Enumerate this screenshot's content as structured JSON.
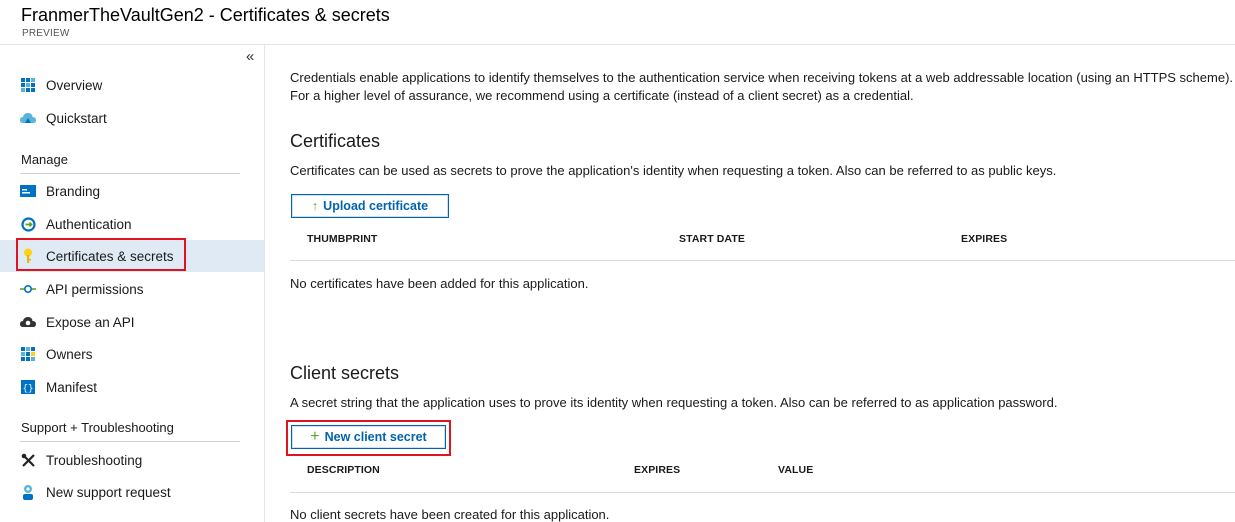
{
  "header": {
    "title": "FranmerTheVaultGen2 - Certificates & secrets",
    "subtitle": "PREVIEW"
  },
  "sidebar": {
    "collapse_glyph": "«",
    "items_top": [
      {
        "label": "Overview",
        "icon": "overview-grid-icon"
      },
      {
        "label": "Quickstart",
        "icon": "cloud-icon"
      }
    ],
    "manage_header": "Manage",
    "manage_items": [
      {
        "label": "Branding",
        "icon": "branding-card-icon"
      },
      {
        "label": "Authentication",
        "icon": "authentication-icon"
      },
      {
        "label": "Certificates & secrets",
        "icon": "key-icon",
        "selected": true
      },
      {
        "label": "API permissions",
        "icon": "api-permissions-icon"
      },
      {
        "label": "Expose an API",
        "icon": "cloud-gear-icon"
      },
      {
        "label": "Owners",
        "icon": "owners-grid-icon"
      },
      {
        "label": "Manifest",
        "icon": "manifest-icon"
      }
    ],
    "support_header": "Support + Troubleshooting",
    "support_items": [
      {
        "label": "Troubleshooting",
        "icon": "wrench-icon"
      },
      {
        "label": "New support request",
        "icon": "support-person-icon"
      }
    ]
  },
  "main": {
    "intro": "Credentials enable applications to identify themselves to the authentication service when receiving tokens at a web addressable location (using an HTTPS scheme). For a higher level of assurance, we recommend using a certificate (instead of a client secret) as a credential.",
    "certificates": {
      "heading": "Certificates",
      "description": "Certificates can be used as secrets to prove the application's identity when requesting a token. Also can be referred to as public keys.",
      "button_label": "Upload certificate",
      "button_glyph": "↑",
      "columns": [
        "THUMBPRINT",
        "START DATE",
        "EXPIRES"
      ],
      "empty_message": "No certificates have been added for this application."
    },
    "client_secrets": {
      "heading": "Client secrets",
      "description": "A secret string that the application uses to prove its identity when requesting a token. Also can be referred to as application password.",
      "button_label": "New client secret",
      "button_glyph": "+",
      "columns": [
        "DESCRIPTION",
        "EXPIRES",
        "VALUE"
      ],
      "empty_message": "No client secrets have been created for this application."
    }
  },
  "colors": {
    "accent": "#0063b1",
    "selected_bg": "#dfeaf5",
    "highlight_red": "#e0141e",
    "add_green": "#5ea428"
  }
}
